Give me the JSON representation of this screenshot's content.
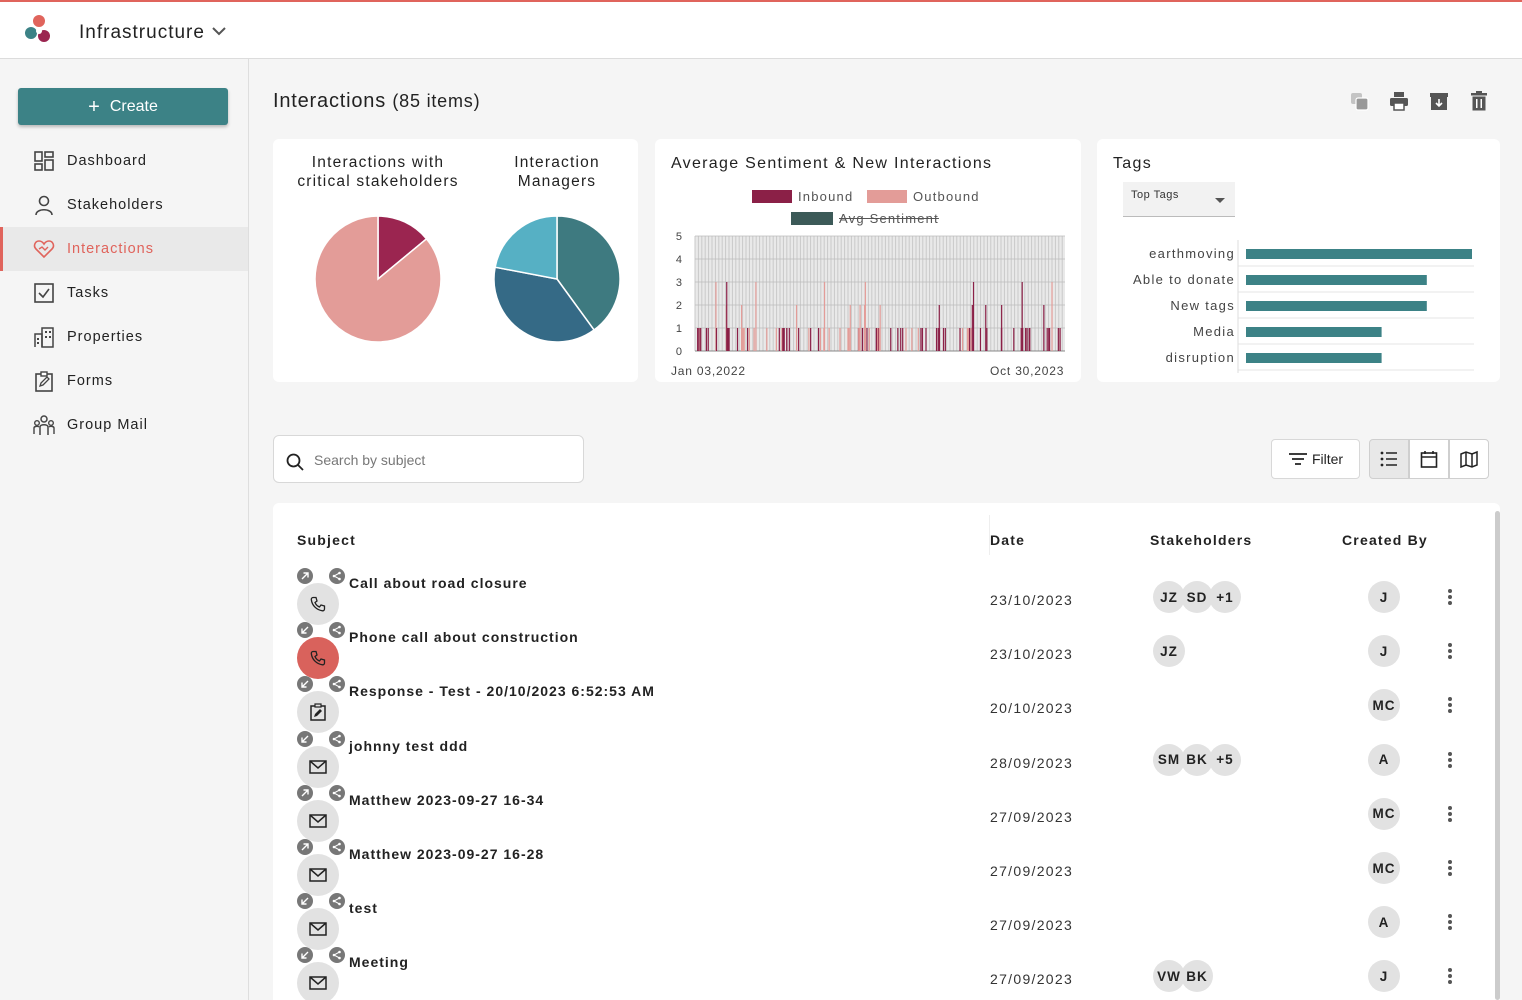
{
  "header": {
    "workspace": "Infrastructure"
  },
  "sidebar": {
    "create_label": "Create",
    "items": [
      {
        "label": "Dashboard",
        "icon": "dashboard-icon"
      },
      {
        "label": "Stakeholders",
        "icon": "person-icon"
      },
      {
        "label": "Interactions",
        "icon": "heart-handshake-icon",
        "active": true
      },
      {
        "label": "Tasks",
        "icon": "checkbox-icon"
      },
      {
        "label": "Properties",
        "icon": "building-icon"
      },
      {
        "label": "Forms",
        "icon": "form-icon"
      },
      {
        "label": "Group Mail",
        "icon": "group-icon"
      }
    ]
  },
  "page": {
    "title": "Interactions",
    "count": "(85 items)"
  },
  "colors": {
    "accent": "#e0645c",
    "primary": "#3c8286",
    "inbound": "#8b2047",
    "outbound": "#e39c98",
    "avg_sentiment": "#3c5a58"
  },
  "charts": {
    "critical": {
      "title_line1": "Interactions with",
      "title_line2": "critical stakeholders"
    },
    "managers": {
      "title_line1": "Interaction",
      "title_line2": "Managers"
    },
    "sentiment": {
      "title": "Average Sentiment & New Interactions",
      "legend_inbound": "Inbound",
      "legend_outbound": "Outbound",
      "legend_avg": "Avg Sentiment",
      "x_start": "Jan 03,2022",
      "x_end": "Oct 30,2023"
    },
    "tags": {
      "title": "Tags",
      "select_value": "Top Tags"
    }
  },
  "chart_data": [
    {
      "type": "pie",
      "title": "Interactions with critical stakeholders",
      "values": [
        14,
        86
      ],
      "colors": [
        "#9b2550",
        "#e39c98"
      ]
    },
    {
      "type": "pie",
      "title": "Interaction Managers",
      "values": [
        40,
        38,
        22
      ],
      "colors": [
        "#3e7a80",
        "#356a86",
        "#56b0c4"
      ]
    },
    {
      "type": "bar",
      "title": "Average Sentiment & New Interactions",
      "ylim": [
        0,
        5
      ],
      "yticks": [
        0,
        1,
        2,
        3,
        4,
        5
      ],
      "x_range": [
        "Jan 03,2022",
        "Oct 30,2023"
      ],
      "grid": true
    },
    {
      "type": "bar",
      "title": "Tags",
      "orientation": "horizontal",
      "categories": [
        "earthmoving",
        "Able to donate",
        "New tags",
        "Media",
        "disruption"
      ],
      "values": [
        5,
        4,
        4,
        3,
        3
      ]
    }
  ],
  "search": {
    "placeholder": "Search by subject"
  },
  "toolbar": {
    "filter_label": "Filter"
  },
  "table": {
    "headers": {
      "subject": "Subject",
      "date": "Date",
      "stakeholders": "Stakeholders",
      "created_by": "Created By"
    },
    "rows": [
      {
        "subject": "Call about road closure",
        "date": "23/10/2023",
        "stakeholders": [
          "JZ",
          "SD",
          "+1"
        ],
        "created_by": "J",
        "type": "phone",
        "direction": "outbound"
      },
      {
        "subject": "Phone call about construction",
        "date": "23/10/2023",
        "stakeholders": [
          "JZ"
        ],
        "created_by": "J",
        "type": "phone-red",
        "direction": "inbound"
      },
      {
        "subject": "Response - Test - 20/10/2023 6:52:53 AM",
        "date": "20/10/2023",
        "stakeholders": [],
        "created_by": "MC",
        "type": "form",
        "direction": "inbound"
      },
      {
        "subject": "johnny test ddd",
        "date": "28/09/2023",
        "stakeholders": [
          "SM",
          "BK",
          "+5"
        ],
        "created_by": "A",
        "type": "email",
        "direction": "inbound"
      },
      {
        "subject": "Matthew 2023-09-27 16-34",
        "date": "27/09/2023",
        "stakeholders": [],
        "created_by": "MC",
        "type": "email",
        "direction": "outbound"
      },
      {
        "subject": "Matthew 2023-09-27 16-28",
        "date": "27/09/2023",
        "stakeholders": [],
        "created_by": "MC",
        "type": "email",
        "direction": "outbound"
      },
      {
        "subject": "test",
        "date": "27/09/2023",
        "stakeholders": [],
        "created_by": "A",
        "type": "email",
        "direction": "inbound"
      },
      {
        "subject": "Meeting",
        "date": "27/09/2023",
        "stakeholders": [
          "VW",
          "BK"
        ],
        "created_by": "J",
        "type": "email",
        "direction": "inbound"
      }
    ]
  }
}
